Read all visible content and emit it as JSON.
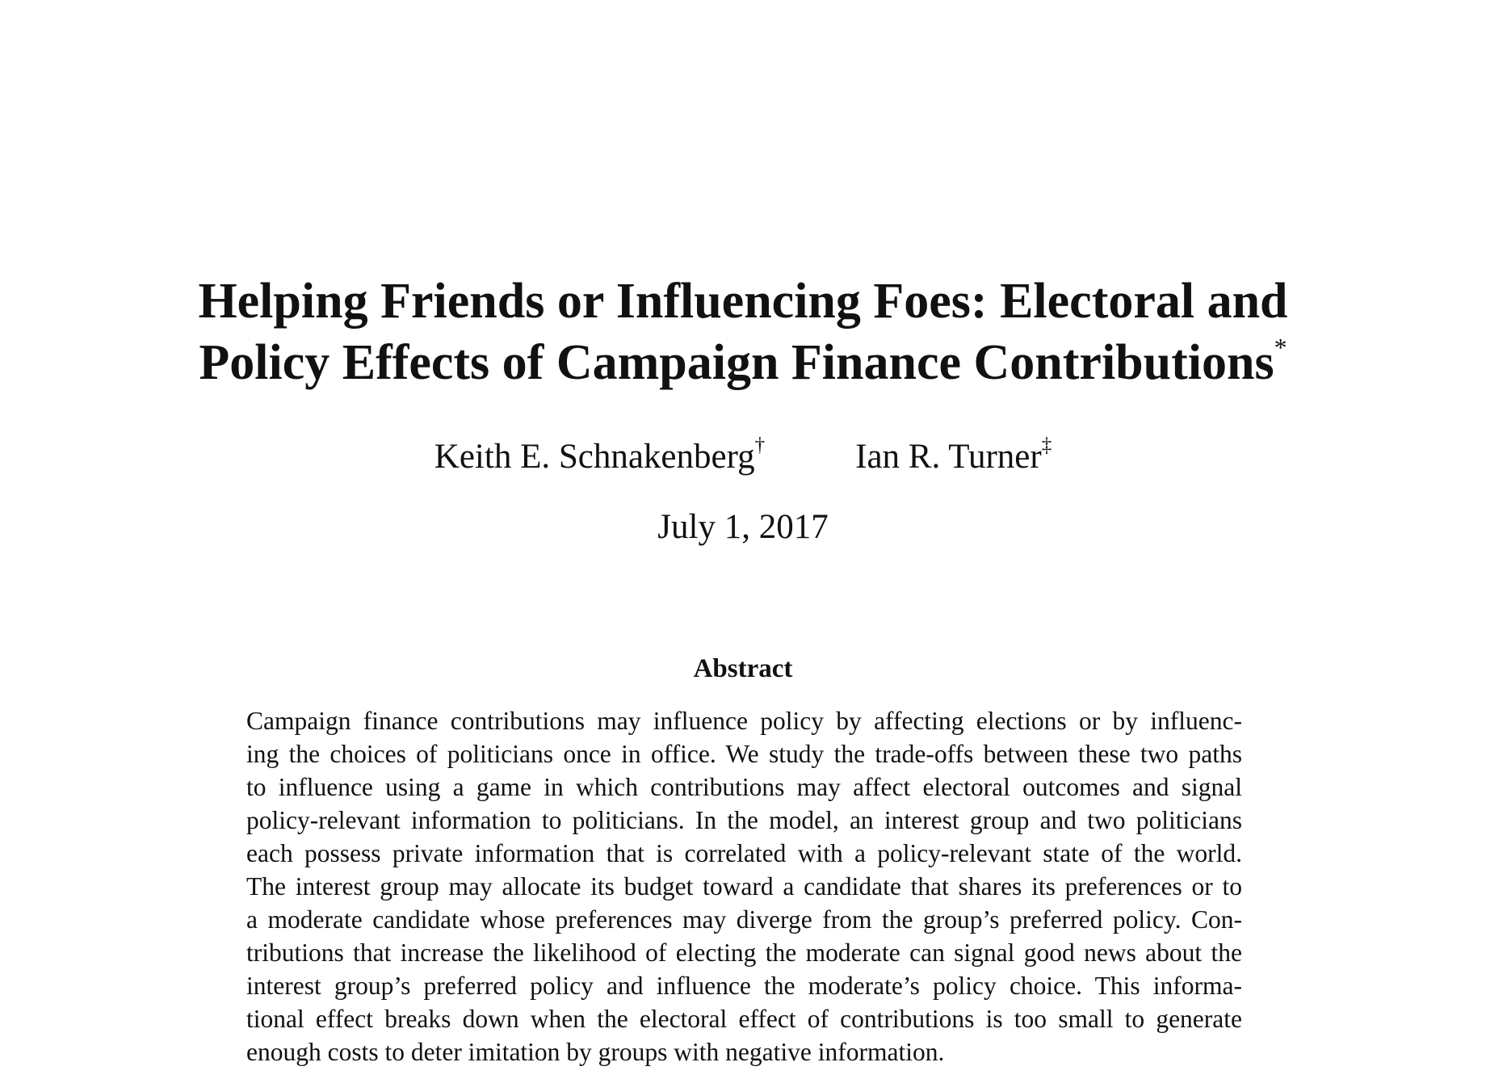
{
  "title": {
    "line1": "Helping Friends or Influencing Foes: Electoral and",
    "line2": "Policy Effects of Campaign Finance Contributions",
    "footnote_mark": "*"
  },
  "authors": [
    {
      "name": "Keith E. Schnakenberg",
      "mark": "†"
    },
    {
      "name": "Ian R. Turner",
      "mark": "‡"
    }
  ],
  "date": "July 1, 2017",
  "abstract": {
    "heading": "Abstract",
    "lines": [
      "Campaign finance contributions may influence policy by affecting elections or by influenc-",
      "ing the choices of politicians once in office. We study the trade-offs between these two paths",
      "to influence using a game in which contributions may affect electoral outcomes and signal",
      "policy-relevant information to politicians. In the model, an interest group and two politicians",
      "each possess private information that is correlated with a policy-relevant state of the world.",
      "The interest group may allocate its budget toward a candidate that shares its preferences or to",
      "a moderate candidate whose preferences may diverge from the group’s preferred policy. Con-",
      "tributions that increase the likelihood of electing the moderate can signal good news about the",
      "interest group’s preferred policy and influence the moderate’s policy choice. This informa-",
      "tional effect breaks down when the electoral effect of contributions is too small to generate",
      "enough costs to deter imitation by groups with negative information."
    ]
  }
}
